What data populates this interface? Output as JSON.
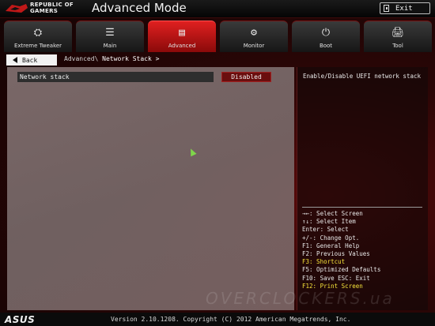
{
  "header": {
    "brand_line1": "REPUBLIC OF",
    "brand_line2": "GAMERS",
    "title": "Advanced Mode",
    "exit_label": "Exit"
  },
  "tabs": [
    {
      "label": "Extreme Tweaker",
      "icon": "gauge-icon",
      "glyph": "⛭"
    },
    {
      "label": "Main",
      "icon": "list-icon",
      "glyph": "☰"
    },
    {
      "label": "Advanced",
      "icon": "advanced-icon",
      "glyph": "▤"
    },
    {
      "label": "Monitor",
      "icon": "monitor-icon",
      "glyph": "⚙"
    },
    {
      "label": "Boot",
      "icon": "power-icon",
      "glyph": "⏻"
    },
    {
      "label": "Tool",
      "icon": "tool-icon",
      "glyph": "🖨"
    }
  ],
  "active_tab": "Advanced",
  "nav": {
    "back_label": "Back",
    "breadcrumb_parent": "Advanced\\ ",
    "breadcrumb_current": "Network Stack >"
  },
  "option": {
    "label": "Network stack",
    "value": "Disabled"
  },
  "help": {
    "text": "Enable/Disable UEFI network stack"
  },
  "shortcuts": [
    {
      "text": "→←: Select Screen",
      "highlight": false
    },
    {
      "text": "↑↓: Select Item",
      "highlight": false
    },
    {
      "text": "Enter: Select",
      "highlight": false
    },
    {
      "text": "+/-: Change Opt.",
      "highlight": false
    },
    {
      "text": "F1: General Help",
      "highlight": false
    },
    {
      "text": "F2: Previous Values",
      "highlight": false
    },
    {
      "text": "F3: Shortcut",
      "highlight": true
    },
    {
      "text": "F5: Optimized Defaults",
      "highlight": false
    },
    {
      "text": "F10: Save  ESC: Exit",
      "highlight": false
    },
    {
      "text": "F12: Print Screen",
      "highlight": true
    }
  ],
  "footer": {
    "brand": "ASUS",
    "version": "Version 2.10.1208. Copyright (C) 2012 American Megatrends, Inc."
  },
  "watermark": "OVERCLOCKERS.ua",
  "colors": {
    "accent": "#e02020",
    "highlight": "#f5e23a"
  }
}
